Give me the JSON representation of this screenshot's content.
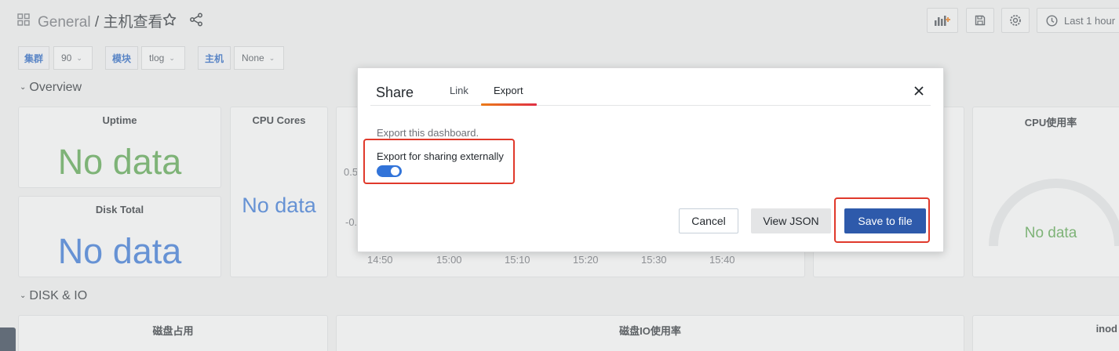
{
  "header": {
    "folder": "General",
    "separator": " / ",
    "dashboard_title": "主机查看",
    "time_range": "Last 1 hour"
  },
  "variables": [
    {
      "label": "集群",
      "value": "90"
    },
    {
      "label": "模块",
      "value": "tlog"
    },
    {
      "label": "主机",
      "value": "None"
    }
  ],
  "rows": {
    "overview": "Overview",
    "disk_io": "DISK & IO"
  },
  "panels": {
    "uptime": {
      "title": "Uptime",
      "value": "No data"
    },
    "cpu_cores": {
      "title": "CPU Cores",
      "value": "No data"
    },
    "disk_total": {
      "title": "Disk Total",
      "value": "No data"
    },
    "cpu_usage": {
      "title": "CPU使用率",
      "value": "No data"
    },
    "disk_usage": {
      "title": "磁盘占用"
    },
    "disk_io_usage": {
      "title": "磁盘IO使用率"
    },
    "inode": {
      "title": "inod"
    }
  },
  "graph": {
    "y_ticks": [
      "0.5",
      "-0."
    ],
    "x_ticks": [
      "14:50",
      "15:00",
      "15:10",
      "15:20",
      "15:30",
      "15:40"
    ]
  },
  "modal": {
    "title": "Share",
    "tabs": [
      {
        "label": "Link",
        "active": false
      },
      {
        "label": "Export",
        "active": true
      }
    ],
    "description": "Export this dashboard.",
    "option_label": "Export for sharing externally",
    "option_enabled": true,
    "buttons": {
      "cancel": "Cancel",
      "view_json": "View JSON",
      "save": "Save to file"
    }
  },
  "colors": {
    "primary": "#2e5aab",
    "toggle_on": "#3274d9",
    "nodata_green": "#56a64b",
    "nodata_blue": "#3274d9",
    "highlight": "#e0392b",
    "tab_underline": "#eb7b18"
  }
}
